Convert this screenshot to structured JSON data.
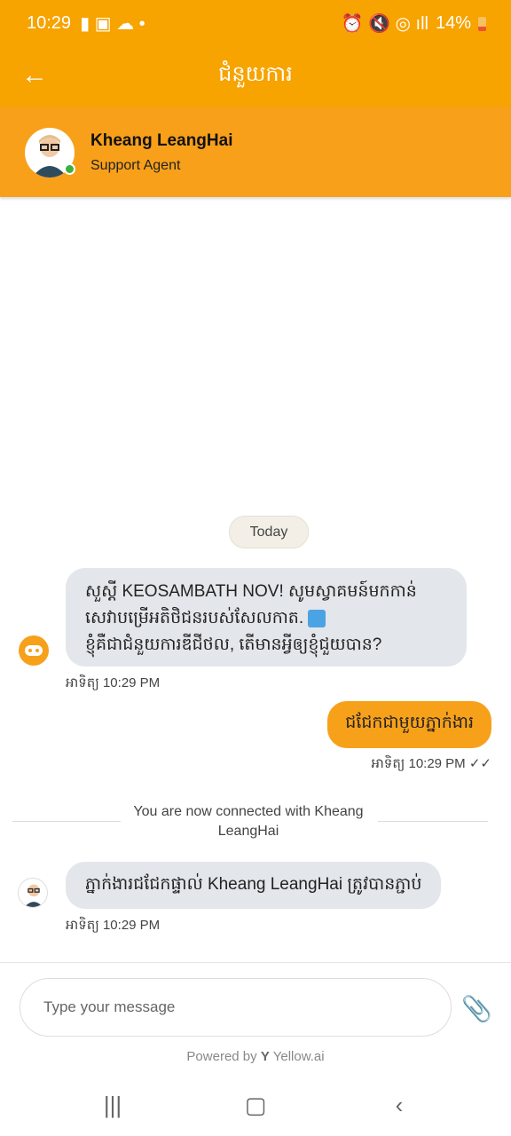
{
  "status_bar": {
    "time": "10:29",
    "battery": "14%"
  },
  "header": {
    "title": "ជំនួយការ"
  },
  "agent": {
    "name": "Kheang LeangHai",
    "role": "Support Agent"
  },
  "chat": {
    "date_chip": "Today",
    "messages": [
      {
        "from": "bot",
        "line1": "សួស្តី KEOSAMBATH NOV! សូមស្វាគមន៍មកកាន់",
        "line2": "សេវាបម្រើអតិថិជនរបស់សែលកាត.",
        "line3": "ខ្ញុំគឺជាជំនួយការឌីជីថល, តើមានអ្វីឲ្យខ្ញុំជួយបាន?",
        "time": "អាទិត្យ 10:29 PM"
      },
      {
        "from": "user",
        "text": "ជជែកជាមួយភ្នាក់ងារ",
        "time": "អាទិត្យ 10:29 PM"
      },
      {
        "from": "system",
        "text": "You are now connected with Kheang LeangHai"
      },
      {
        "from": "agent",
        "text": "ភ្នាក់ងារជជែកផ្ទាល់ Kheang  LeangHai ត្រូវបានភ្ជាប់",
        "time": "អាទិត្យ 10:29 PM"
      }
    ]
  },
  "composer": {
    "placeholder": "Type your message"
  },
  "powered": {
    "prefix": "Powered by",
    "brand": "Yellow.ai"
  },
  "colors": {
    "accent": "#f7a300"
  }
}
